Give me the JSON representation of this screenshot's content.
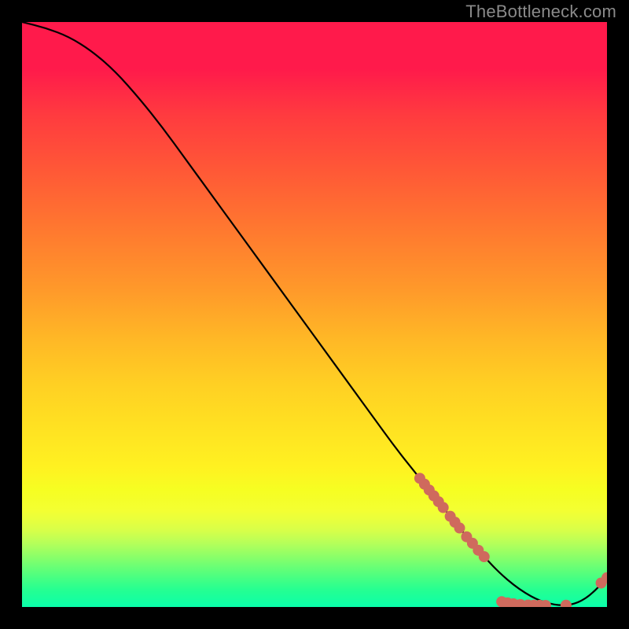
{
  "attribution": "TheBottleneck.com",
  "chart_data": {
    "type": "line",
    "title": "",
    "xlabel": "",
    "ylabel": "",
    "xlim": [
      0,
      100
    ],
    "ylim": [
      0,
      100
    ],
    "series": [
      {
        "name": "bottleneck-curve",
        "x": [
          0,
          4,
          8,
          12,
          16,
          20,
          24,
          28,
          32,
          36,
          40,
          44,
          48,
          52,
          56,
          60,
          64,
          68,
          72,
          76,
          80,
          82,
          84,
          86,
          88,
          90,
          92,
          94,
          96,
          98,
          100
        ],
        "y": [
          100,
          99,
          97.5,
          95,
          91.5,
          87,
          82,
          76.5,
          71,
          65.5,
          60,
          54.5,
          49,
          43.5,
          38,
          32.5,
          27,
          22,
          17,
          12,
          7.5,
          5.5,
          3.8,
          2.4,
          1.3,
          0.6,
          0.25,
          0.4,
          1.2,
          2.8,
          5.0
        ]
      }
    ],
    "markers": [
      {
        "x": 68.0,
        "y": 22.0
      },
      {
        "x": 68.8,
        "y": 21.0
      },
      {
        "x": 69.6,
        "y": 20.0
      },
      {
        "x": 70.4,
        "y": 19.0
      },
      {
        "x": 71.2,
        "y": 18.0
      },
      {
        "x": 72.0,
        "y": 17.0
      },
      {
        "x": 73.2,
        "y": 15.5
      },
      {
        "x": 74.0,
        "y": 14.5
      },
      {
        "x": 74.8,
        "y": 13.5
      },
      {
        "x": 76.0,
        "y": 12.0
      },
      {
        "x": 77.0,
        "y": 10.9
      },
      {
        "x": 78.0,
        "y": 9.7
      },
      {
        "x": 79.0,
        "y": 8.6
      },
      {
        "x": 82.0,
        "y": 0.9
      },
      {
        "x": 83.0,
        "y": 0.7
      },
      {
        "x": 84.0,
        "y": 0.55
      },
      {
        "x": 85.2,
        "y": 0.42
      },
      {
        "x": 86.5,
        "y": 0.33
      },
      {
        "x": 87.5,
        "y": 0.3
      },
      {
        "x": 88.5,
        "y": 0.28
      },
      {
        "x": 89.5,
        "y": 0.27
      },
      {
        "x": 93.0,
        "y": 0.3
      },
      {
        "x": 99.0,
        "y": 4.1
      },
      {
        "x": 100.0,
        "y": 5.0
      }
    ],
    "marker_radius_px": 7
  },
  "colors": {
    "marker": "#cf6a5d",
    "curve": "#000000",
    "attribution": "#8a8a8a"
  }
}
